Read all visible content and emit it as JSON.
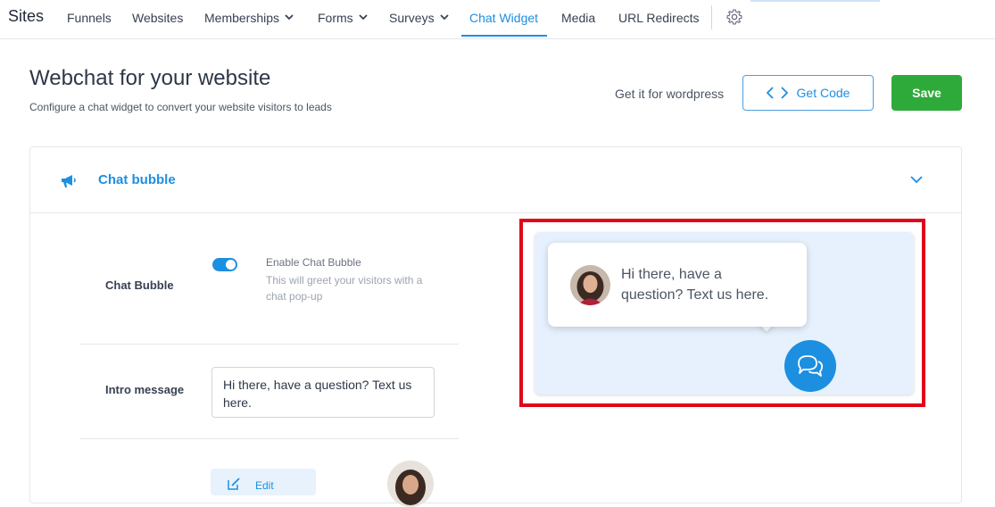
{
  "nav": {
    "brand": "Sites",
    "items": [
      {
        "label": "Funnels"
      },
      {
        "label": "Websites"
      },
      {
        "label": "Memberships"
      },
      {
        "label": "Forms"
      },
      {
        "label": "Surveys"
      },
      {
        "label": "Chat Widget"
      },
      {
        "label": "Media"
      },
      {
        "label": "URL Redirects"
      }
    ],
    "active": "Chat Widget",
    "settings_icon": "gear-icon"
  },
  "header": {
    "title": "Webchat for your website",
    "subtitle": "Configure a chat widget to convert your website visitors to leads",
    "wordpress_link": "Get it for wordpress",
    "get_code_label": "Get Code",
    "save_label": "Save"
  },
  "card": {
    "title": "Chat bubble",
    "chat_bubble_label": "Chat Bubble",
    "toggle_title": "Enable Chat Bubble",
    "toggle_desc": "This will greet your visitors with a chat pop-up",
    "toggle_on": true,
    "intro_label": "Intro message",
    "intro_value": "Hi there, have a question? Text us here.",
    "edit_label": "Edit"
  },
  "preview": {
    "message": "Hi there, have a question? Text us here."
  },
  "colors": {
    "accent": "#1d8fe1",
    "save": "#2eaa3b",
    "highlight": "#e0061a",
    "preview_bg": "#e6f1fd"
  }
}
